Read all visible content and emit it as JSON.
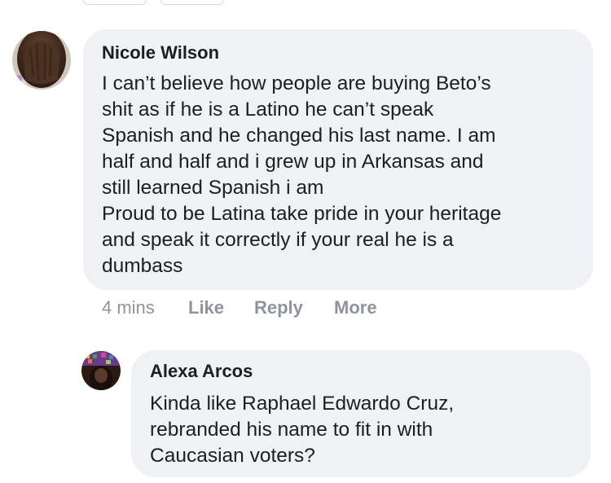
{
  "comments": [
    {
      "author": "Nicole Wilson",
      "text": "I can’t believe how people are buying Beto’s\nshit as if he is a Latino he can’t speak\nSpanish and he changed his last name. I am\nhalf and half and i grew up in Arkansas and\nstill learned Spanish i am\nProud to be Latina take pride in your heritage\nand speak it correctly if your real he is a\ndumbass",
      "time": "4 mins",
      "like_label": "Like",
      "reply_label": "Reply",
      "more_label": "More"
    }
  ],
  "replies": [
    {
      "author": "Alexa Arcos",
      "text": "Kinda like Raphael Edwardo Cruz,\nrebranded his name to fit in with\nCaucasian voters?"
    }
  ],
  "colors": {
    "bubble": "#f0f1f4",
    "text": "#1c1e21",
    "meta": "#8d949e"
  }
}
